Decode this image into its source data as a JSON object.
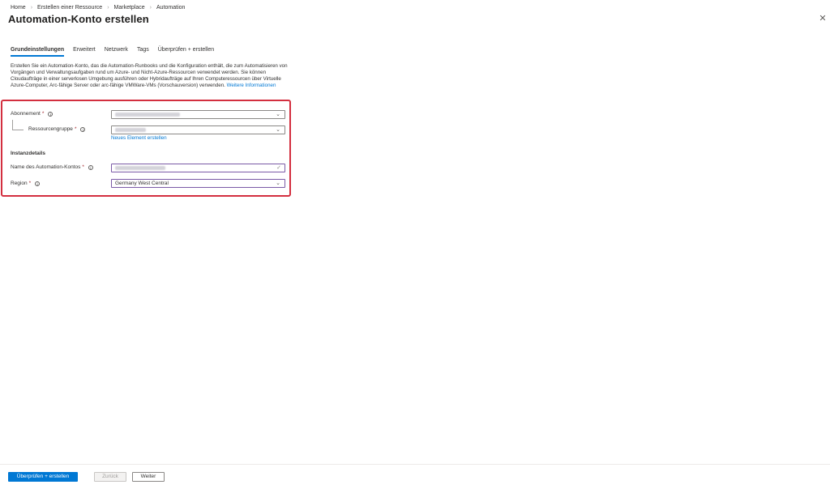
{
  "breadcrumb": [
    "Home",
    "Erstellen einer Ressource",
    "Marketplace",
    "Automation"
  ],
  "page": {
    "title": "Automation-Konto erstellen",
    "more": "···",
    "close": "✕"
  },
  "tabs": [
    {
      "label": "Grundeinstellungen",
      "active": true
    },
    {
      "label": "Erweitert"
    },
    {
      "label": "Netzwerk"
    },
    {
      "label": "Tags"
    },
    {
      "label": "Überprüfen + erstellen"
    }
  ],
  "intro": {
    "text": "Erstellen Sie ein Automation-Konto, das die Automation-Runbooks und die Konfiguration enthält, die zum Automatisieren von Vorgängen und Verwaltungsaufgaben rund um Azure- und Nicht-Azure-Ressourcen verwendet werden. Sie können Cloudaufträge in einer serverlosen Umgebung ausführen oder Hybridaufträge auf Ihren Computeressourcen über Virtuelle Azure-Computer, Arc-fähige Server oder arc-fähige VMWare-VMs (Vorschauversion) verwenden.",
    "link": "Weitere Informationen"
  },
  "form": {
    "subscription": {
      "label": "Abonnement",
      "required": "*"
    },
    "resource_group": {
      "label": "Ressourcengruppe",
      "required": "*",
      "create_link": "Neues Element erstellen"
    },
    "instance_heading": "Instanzdetails",
    "account_name": {
      "label": "Name des Automation-Kontos",
      "required": "*"
    },
    "region": {
      "label": "Region",
      "required": "*",
      "value": "Germany West Central"
    }
  },
  "icons": {
    "info": "i",
    "chevron": "⌄",
    "check": "✓"
  },
  "footer": {
    "primary": "Überprüfen + erstellen",
    "back": "Zurück",
    "next": "Weiter"
  },
  "colors": {
    "accent": "#0078d4",
    "highlight": "#d32f3f"
  }
}
